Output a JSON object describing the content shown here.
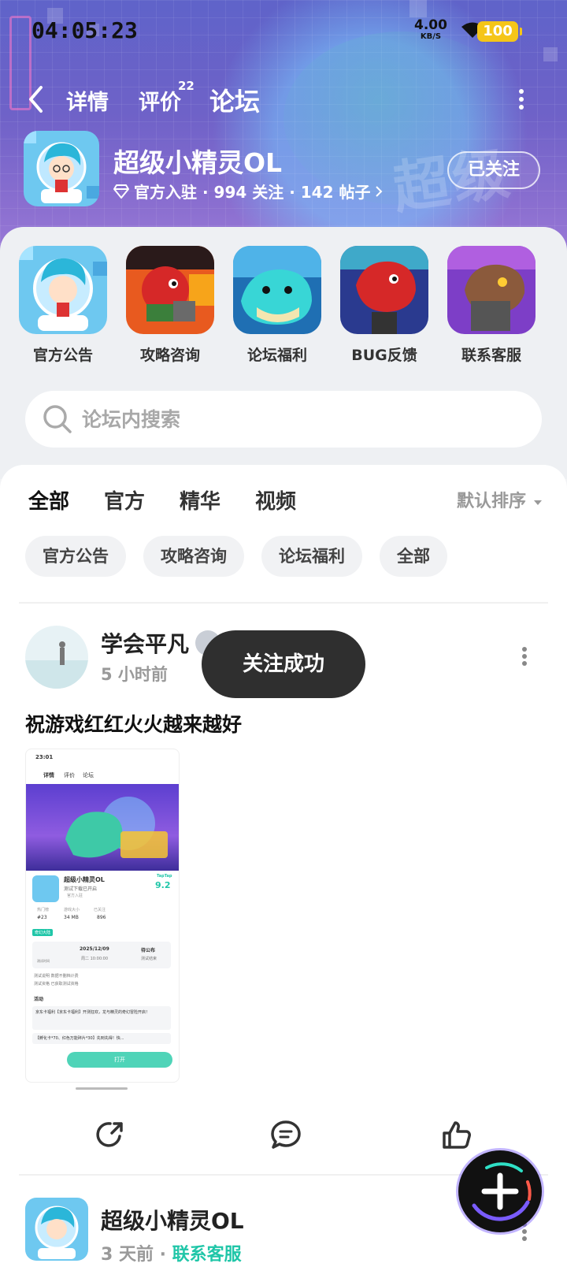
{
  "status_bar": {
    "time": "04:05:23",
    "net_speed": "4.00",
    "net_unit": "KB/S",
    "battery": "100"
  },
  "nav": {
    "tabs": [
      {
        "label": "详情"
      },
      {
        "label": "评价",
        "badge": "22"
      },
      {
        "label": "论坛"
      }
    ],
    "active_tab": "论坛"
  },
  "game": {
    "name": "超级小精灵OL",
    "meta": "官方入驻 · 994 关注 · 142 帖子",
    "follow_label": "已关注",
    "banner_title": "超级"
  },
  "categories": [
    {
      "label": "官方公告"
    },
    {
      "label": "攻略咨询"
    },
    {
      "label": "论坛福利"
    },
    {
      "label": "BUG反馈"
    },
    {
      "label": "联系客服"
    }
  ],
  "search": {
    "placeholder": "论坛内搜索"
  },
  "feed": {
    "tabs": [
      {
        "label": "全部"
      },
      {
        "label": "官方"
      },
      {
        "label": "精华"
      },
      {
        "label": "视频"
      }
    ],
    "active_tab": "全部",
    "sort_label": "默认排序",
    "chips": [
      {
        "label": "官方公告"
      },
      {
        "label": "攻略咨询"
      },
      {
        "label": "论坛福利"
      },
      {
        "label": "全部"
      }
    ]
  },
  "post1": {
    "author": "学会平凡",
    "time": "5 小时前",
    "title": "祝游戏红红火火越来越好",
    "screenshot": {
      "time": "23:01",
      "tabs": [
        "详情",
        "评价",
        "论坛"
      ],
      "game_name": "超级小精灵OL",
      "subtitle": "测试下载已开启",
      "official": "官方入驻",
      "rating_brand": "TapTap",
      "rating": "9.2",
      "stats": [
        {
          "label": "热门榜",
          "value": "#23"
        },
        {
          "label": "游戏大小",
          "value": "34 MB"
        },
        {
          "label": "已关注",
          "value": "896"
        }
      ],
      "test_tag": "奇幻大陆",
      "test_date": "2025/12/09",
      "test_time": "周二 10:00:00",
      "test_end": "待公布",
      "test_start_label": "测试时间",
      "test_end_label": "测试结束",
      "rule1": "测试说明  数据不删档计费",
      "rule2": "测试资格  已获取测试资格",
      "activity_label": "活动",
      "activity1": "京东卡福利【京东卡福利】开测狂欢，龙与精灵的奇幻冒险开启！",
      "activity2": "【孵化卡*70、红色万能碎片*30】先到先得！快...",
      "open_btn": "打开"
    }
  },
  "toast": "关注成功",
  "post2": {
    "author": "超级小精灵OL",
    "time": "3 天前",
    "tag": "联系客服"
  },
  "colors": {
    "accent": "#2fe0c6",
    "tag_green": "#20c6a8",
    "battery": "#f5c518",
    "toast_bg": "#2f2f2f"
  }
}
